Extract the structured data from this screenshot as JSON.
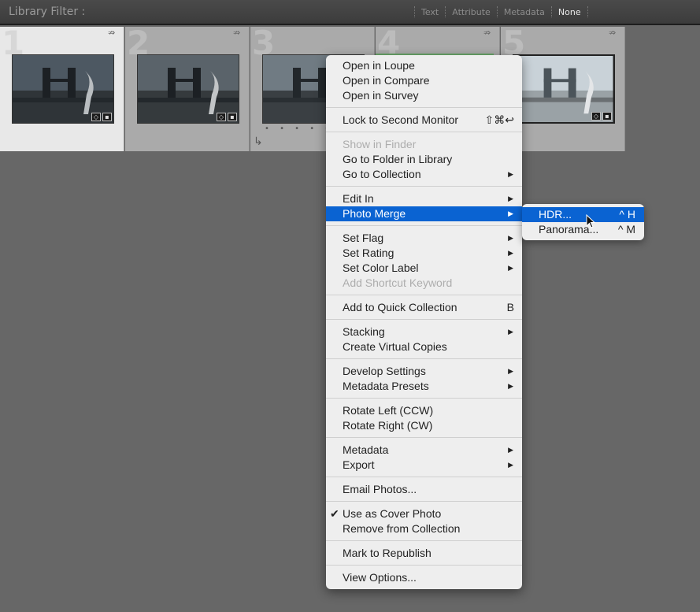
{
  "filter_bar": {
    "title": "Library Filter :",
    "tabs": [
      "Text",
      "Attribute",
      "Metadata",
      "None"
    ],
    "active_tab": "None"
  },
  "grid": {
    "cells": [
      {
        "number": "1",
        "selected": true
      },
      {
        "number": "2",
        "selected": false
      },
      {
        "number": "3",
        "selected": false
      },
      {
        "number": "4",
        "selected": false
      },
      {
        "number": "5",
        "selected": false
      }
    ],
    "rating_dots": "• • • • •"
  },
  "menu": {
    "open_in_loupe": "Open in Loupe",
    "open_in_compare": "Open in Compare",
    "open_in_survey": "Open in Survey",
    "lock_to_second_monitor": "Lock to Second Monitor",
    "lock_shortcut": "⇧⌘↩",
    "show_in_finder": "Show in Finder",
    "go_to_folder": "Go to Folder in Library",
    "go_to_collection": "Go to Collection",
    "edit_in": "Edit In",
    "photo_merge": "Photo Merge",
    "set_flag": "Set Flag",
    "set_rating": "Set Rating",
    "set_color_label": "Set Color Label",
    "add_shortcut_keyword": "Add Shortcut Keyword",
    "add_to_quick_collection": "Add to Quick Collection",
    "quick_collection_shortcut": "B",
    "stacking": "Stacking",
    "create_virtual_copies": "Create Virtual Copies",
    "develop_settings": "Develop Settings",
    "metadata_presets": "Metadata Presets",
    "rotate_left": "Rotate Left (CCW)",
    "rotate_right": "Rotate Right (CW)",
    "metadata": "Metadata",
    "export": "Export",
    "email_photos": "Email Photos...",
    "use_as_cover_photo": "Use as Cover Photo",
    "check_mark": "✔",
    "remove_from_collection": "Remove from Collection",
    "mark_to_republish": "Mark to Republish",
    "view_options": "View Options..."
  },
  "submenu": {
    "hdr": "HDR...",
    "hdr_shortcut": "^ H",
    "panorama": "Panorama...",
    "panorama_shortcut": "^ M"
  },
  "colors": {
    "highlight": "#0a63d2",
    "background": "#676767",
    "menu_bg": "#eeeeee"
  }
}
